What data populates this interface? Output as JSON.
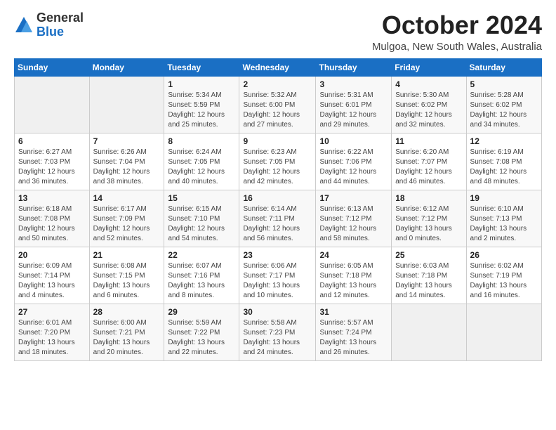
{
  "header": {
    "logo_general": "General",
    "logo_blue": "Blue",
    "month_title": "October 2024",
    "location": "Mulgoa, New South Wales, Australia"
  },
  "weekdays": [
    "Sunday",
    "Monday",
    "Tuesday",
    "Wednesday",
    "Thursday",
    "Friday",
    "Saturday"
  ],
  "weeks": [
    [
      {
        "day": "",
        "detail": ""
      },
      {
        "day": "",
        "detail": ""
      },
      {
        "day": "1",
        "detail": "Sunrise: 5:34 AM\nSunset: 5:59 PM\nDaylight: 12 hours\nand 25 minutes."
      },
      {
        "day": "2",
        "detail": "Sunrise: 5:32 AM\nSunset: 6:00 PM\nDaylight: 12 hours\nand 27 minutes."
      },
      {
        "day": "3",
        "detail": "Sunrise: 5:31 AM\nSunset: 6:01 PM\nDaylight: 12 hours\nand 29 minutes."
      },
      {
        "day": "4",
        "detail": "Sunrise: 5:30 AM\nSunset: 6:02 PM\nDaylight: 12 hours\nand 32 minutes."
      },
      {
        "day": "5",
        "detail": "Sunrise: 5:28 AM\nSunset: 6:02 PM\nDaylight: 12 hours\nand 34 minutes."
      }
    ],
    [
      {
        "day": "6",
        "detail": "Sunrise: 6:27 AM\nSunset: 7:03 PM\nDaylight: 12 hours\nand 36 minutes."
      },
      {
        "day": "7",
        "detail": "Sunrise: 6:26 AM\nSunset: 7:04 PM\nDaylight: 12 hours\nand 38 minutes."
      },
      {
        "day": "8",
        "detail": "Sunrise: 6:24 AM\nSunset: 7:05 PM\nDaylight: 12 hours\nand 40 minutes."
      },
      {
        "day": "9",
        "detail": "Sunrise: 6:23 AM\nSunset: 7:05 PM\nDaylight: 12 hours\nand 42 minutes."
      },
      {
        "day": "10",
        "detail": "Sunrise: 6:22 AM\nSunset: 7:06 PM\nDaylight: 12 hours\nand 44 minutes."
      },
      {
        "day": "11",
        "detail": "Sunrise: 6:20 AM\nSunset: 7:07 PM\nDaylight: 12 hours\nand 46 minutes."
      },
      {
        "day": "12",
        "detail": "Sunrise: 6:19 AM\nSunset: 7:08 PM\nDaylight: 12 hours\nand 48 minutes."
      }
    ],
    [
      {
        "day": "13",
        "detail": "Sunrise: 6:18 AM\nSunset: 7:08 PM\nDaylight: 12 hours\nand 50 minutes."
      },
      {
        "day": "14",
        "detail": "Sunrise: 6:17 AM\nSunset: 7:09 PM\nDaylight: 12 hours\nand 52 minutes."
      },
      {
        "day": "15",
        "detail": "Sunrise: 6:15 AM\nSunset: 7:10 PM\nDaylight: 12 hours\nand 54 minutes."
      },
      {
        "day": "16",
        "detail": "Sunrise: 6:14 AM\nSunset: 7:11 PM\nDaylight: 12 hours\nand 56 minutes."
      },
      {
        "day": "17",
        "detail": "Sunrise: 6:13 AM\nSunset: 7:12 PM\nDaylight: 12 hours\nand 58 minutes."
      },
      {
        "day": "18",
        "detail": "Sunrise: 6:12 AM\nSunset: 7:12 PM\nDaylight: 13 hours\nand 0 minutes."
      },
      {
        "day": "19",
        "detail": "Sunrise: 6:10 AM\nSunset: 7:13 PM\nDaylight: 13 hours\nand 2 minutes."
      }
    ],
    [
      {
        "day": "20",
        "detail": "Sunrise: 6:09 AM\nSunset: 7:14 PM\nDaylight: 13 hours\nand 4 minutes."
      },
      {
        "day": "21",
        "detail": "Sunrise: 6:08 AM\nSunset: 7:15 PM\nDaylight: 13 hours\nand 6 minutes."
      },
      {
        "day": "22",
        "detail": "Sunrise: 6:07 AM\nSunset: 7:16 PM\nDaylight: 13 hours\nand 8 minutes."
      },
      {
        "day": "23",
        "detail": "Sunrise: 6:06 AM\nSunset: 7:17 PM\nDaylight: 13 hours\nand 10 minutes."
      },
      {
        "day": "24",
        "detail": "Sunrise: 6:05 AM\nSunset: 7:18 PM\nDaylight: 13 hours\nand 12 minutes."
      },
      {
        "day": "25",
        "detail": "Sunrise: 6:03 AM\nSunset: 7:18 PM\nDaylight: 13 hours\nand 14 minutes."
      },
      {
        "day": "26",
        "detail": "Sunrise: 6:02 AM\nSunset: 7:19 PM\nDaylight: 13 hours\nand 16 minutes."
      }
    ],
    [
      {
        "day": "27",
        "detail": "Sunrise: 6:01 AM\nSunset: 7:20 PM\nDaylight: 13 hours\nand 18 minutes."
      },
      {
        "day": "28",
        "detail": "Sunrise: 6:00 AM\nSunset: 7:21 PM\nDaylight: 13 hours\nand 20 minutes."
      },
      {
        "day": "29",
        "detail": "Sunrise: 5:59 AM\nSunset: 7:22 PM\nDaylight: 13 hours\nand 22 minutes."
      },
      {
        "day": "30",
        "detail": "Sunrise: 5:58 AM\nSunset: 7:23 PM\nDaylight: 13 hours\nand 24 minutes."
      },
      {
        "day": "31",
        "detail": "Sunrise: 5:57 AM\nSunset: 7:24 PM\nDaylight: 13 hours\nand 26 minutes."
      },
      {
        "day": "",
        "detail": ""
      },
      {
        "day": "",
        "detail": ""
      }
    ]
  ]
}
